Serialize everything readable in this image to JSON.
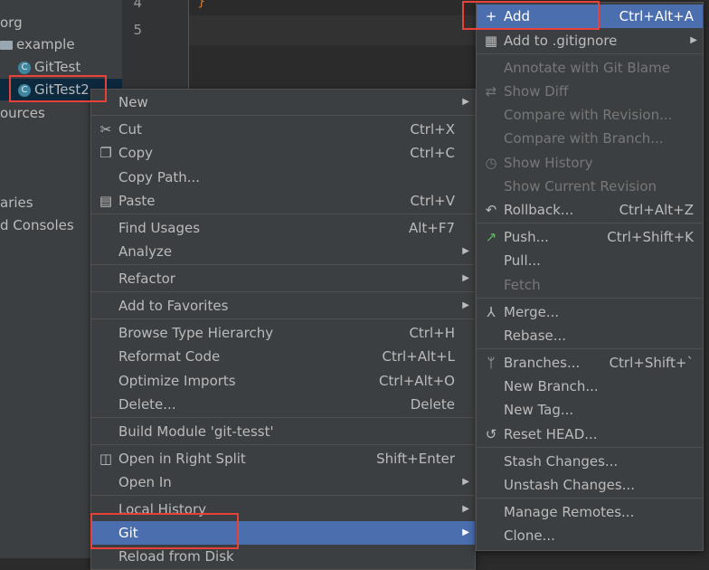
{
  "tree": {
    "items": [
      {
        "label": "org",
        "icon": "none"
      },
      {
        "label": "example",
        "icon": "folder-icon"
      },
      {
        "label": "GitTest",
        "icon": "class-icon"
      },
      {
        "label": "GitTest2",
        "icon": "class-icon"
      },
      {
        "label": "ources",
        "icon": "none"
      },
      {
        "label": "aries",
        "icon": "none"
      },
      {
        "label": "d Consoles",
        "icon": "none"
      }
    ]
  },
  "editor": {
    "lines": [
      "4",
      "5"
    ],
    "code": "}"
  },
  "context_menu": {
    "items": [
      {
        "label": "New",
        "shortcut": "",
        "submenu": true
      },
      {
        "label": "Cut",
        "shortcut": "Ctrl+X",
        "icon": "scissors-icon"
      },
      {
        "label": "Copy",
        "shortcut": "Ctrl+C",
        "icon": "copy-icon"
      },
      {
        "label": "Copy Path...",
        "shortcut": ""
      },
      {
        "label": "Paste",
        "shortcut": "Ctrl+V",
        "icon": "paste-icon"
      },
      {
        "label": "Find Usages",
        "shortcut": "Alt+F7"
      },
      {
        "label": "Analyze",
        "shortcut": "",
        "submenu": true
      },
      {
        "label": "Refactor",
        "shortcut": "",
        "submenu": true
      },
      {
        "label": "Add to Favorites",
        "shortcut": "",
        "submenu": true
      },
      {
        "label": "Browse Type Hierarchy",
        "shortcut": "Ctrl+H"
      },
      {
        "label": "Reformat Code",
        "shortcut": "Ctrl+Alt+L"
      },
      {
        "label": "Optimize Imports",
        "shortcut": "Ctrl+Alt+O"
      },
      {
        "label": "Delete...",
        "shortcut": "Delete"
      },
      {
        "label": "Build Module 'git-tesst'",
        "shortcut": ""
      },
      {
        "label": "Open in Right Split",
        "shortcut": "Shift+Enter",
        "icon": "split-icon"
      },
      {
        "label": "Open In",
        "shortcut": "",
        "submenu": true
      },
      {
        "label": "Local History",
        "shortcut": "",
        "submenu": true
      },
      {
        "label": "Git",
        "shortcut": "",
        "submenu": true
      },
      {
        "label": "Reload from Disk",
        "shortcut": ""
      }
    ]
  },
  "git_menu": {
    "items": [
      {
        "label": "Add",
        "shortcut": "Ctrl+Alt+A",
        "icon": "plus-icon"
      },
      {
        "label": "Add to .gitignore",
        "shortcut": "",
        "icon": "gitignore-icon",
        "submenu": true
      },
      {
        "label": "Annotate with Git Blame",
        "shortcut": ""
      },
      {
        "label": "Show Diff",
        "shortcut": "",
        "icon": "diff-icon"
      },
      {
        "label": "Compare with Revision...",
        "shortcut": ""
      },
      {
        "label": "Compare with Branch...",
        "shortcut": ""
      },
      {
        "label": "Show History",
        "shortcut": "",
        "icon": "clock-icon"
      },
      {
        "label": "Show Current Revision",
        "shortcut": ""
      },
      {
        "label": "Rollback...",
        "shortcut": "Ctrl+Alt+Z",
        "icon": "undo-icon"
      },
      {
        "label": "Push...",
        "shortcut": "Ctrl+Shift+K",
        "icon": "push-arrow-icon"
      },
      {
        "label": "Pull...",
        "shortcut": ""
      },
      {
        "label": "Fetch",
        "shortcut": ""
      },
      {
        "label": "Merge...",
        "shortcut": "",
        "icon": "merge-icon"
      },
      {
        "label": "Rebase...",
        "shortcut": ""
      },
      {
        "label": "Branches...",
        "shortcut": "Ctrl+Shift+`",
        "icon": "branch-icon"
      },
      {
        "label": "New Branch...",
        "shortcut": ""
      },
      {
        "label": "New Tag...",
        "shortcut": ""
      },
      {
        "label": "Reset HEAD...",
        "shortcut": "",
        "icon": "reset-icon"
      },
      {
        "label": "Stash Changes...",
        "shortcut": ""
      },
      {
        "label": "Unstash Changes...",
        "shortcut": ""
      },
      {
        "label": "Manage Remotes...",
        "shortcut": ""
      },
      {
        "label": "Clone...",
        "shortcut": ""
      }
    ]
  },
  "colors": {
    "selection": "#4b6eaf",
    "highlight_box": "#e8413a",
    "menu_bg": "#3c3f41",
    "disabled_text": "#777777"
  }
}
